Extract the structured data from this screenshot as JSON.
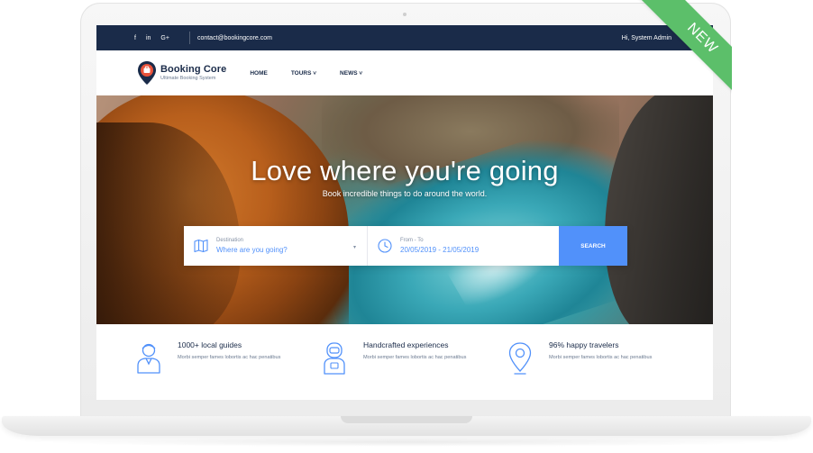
{
  "topbar": {
    "social": [
      "f",
      "in",
      "G+"
    ],
    "email": "contact@bookingcore.com",
    "greeting": "Hi, System Admin"
  },
  "navbar": {
    "brand_name": "Booking Core",
    "brand_tagline": "Ultimate Booking System",
    "links": [
      "HOME",
      "TOURS ˅",
      "NEWS ˅"
    ]
  },
  "hero": {
    "title": "Love where you're going",
    "subtitle": "Book incredible things to do around the world."
  },
  "search": {
    "destination_label": "Destination",
    "destination_placeholder": "Where are you going?",
    "date_label": "From - To",
    "date_value": "20/05/2019 - 21/05/2019",
    "button_label": "SEARCH"
  },
  "features": [
    {
      "title": "1000+ local guides",
      "desc": "Morbi semper fames lobortis ac hac penatibus"
    },
    {
      "title": "Handcrafted experiences",
      "desc": "Morbi semper fames lobortis ac hac penatibus"
    },
    {
      "title": "96% happy travelers",
      "desc": "Morbi semper fames lobortis ac hac penatibus"
    }
  ],
  "badge": {
    "label": "NEW"
  },
  "colors": {
    "navy": "#1a2b49",
    "accent": "#5191fa",
    "badge": "#5cbf6a"
  },
  "icons": [
    "facebook-icon",
    "linkedin-icon",
    "google-plus-icon",
    "logo-pin-icon",
    "map-icon",
    "clock-icon",
    "guide-icon",
    "astronaut-icon",
    "location-pin-icon"
  ]
}
